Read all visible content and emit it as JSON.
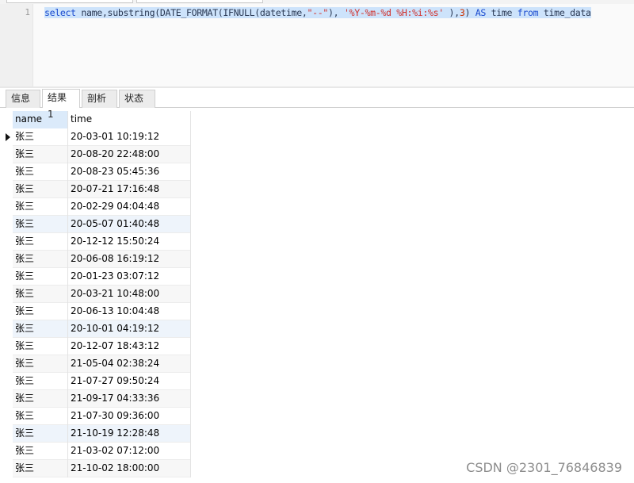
{
  "editor": {
    "line_number": "1",
    "query_parts": [
      {
        "t": "select",
        "c": "kw"
      },
      {
        "t": " name,substring(DATE_FORMAT(IFNULL(datetime,",
        "c": "tx"
      },
      {
        "t": "\"--\"",
        "c": "st"
      },
      {
        "t": "), ",
        "c": "tx"
      },
      {
        "t": "'%Y-%m-%d %H:%i:%s'",
        "c": "st"
      },
      {
        "t": " ),",
        "c": "tx"
      },
      {
        "t": "3",
        "c": "nm"
      },
      {
        "t": ") ",
        "c": "tx"
      },
      {
        "t": "AS",
        "c": "kw"
      },
      {
        "t": " time ",
        "c": "tx"
      },
      {
        "t": "from",
        "c": "kw"
      },
      {
        "t": " time_data",
        "c": "tx"
      }
    ]
  },
  "tabs": [
    {
      "label": "信息",
      "active": false
    },
    {
      "label": "结果 1",
      "active": true
    },
    {
      "label": "剖析",
      "active": false
    },
    {
      "label": "状态",
      "active": false
    }
  ],
  "grid": {
    "columns": [
      "name",
      "time"
    ],
    "rows": [
      [
        "张三",
        "20-03-01 10:19:12"
      ],
      [
        "张三",
        "20-08-20 22:48:00"
      ],
      [
        "张三",
        "20-08-23 05:45:36"
      ],
      [
        "张三",
        "20-07-21 17:16:48"
      ],
      [
        "张三",
        "20-02-29 04:04:48"
      ],
      [
        "张三",
        "20-05-07 01:40:48"
      ],
      [
        "张三",
        "20-12-12 15:50:24"
      ],
      [
        "张三",
        "20-06-08 16:19:12"
      ],
      [
        "张三",
        "20-01-23 03:07:12"
      ],
      [
        "张三",
        "20-03-21 10:48:00"
      ],
      [
        "张三",
        "20-06-13 10:04:48"
      ],
      [
        "张三",
        "20-10-01 04:19:12"
      ],
      [
        "张三",
        "20-12-07 18:43:12"
      ],
      [
        "张三",
        "21-05-04 02:38:24"
      ],
      [
        "张三",
        "21-07-27 09:50:24"
      ],
      [
        "张三",
        "21-09-17 04:33:36"
      ],
      [
        "张三",
        "21-07-30 09:36:00"
      ],
      [
        "张三",
        "21-10-19 12:28:48"
      ],
      [
        "张三",
        "21-03-02 07:12:00"
      ],
      [
        "张三",
        "21-10-02 18:00:00"
      ]
    ],
    "current_row": 0,
    "highlighted_rows": [
      5,
      11,
      17
    ]
  },
  "watermark": "CSDN @2301_76846839",
  "colors": {
    "keyword": "#1a4bcf",
    "string": "#d0302b",
    "selection": "#cde3fb",
    "header_highlight": "#dbeafa"
  }
}
